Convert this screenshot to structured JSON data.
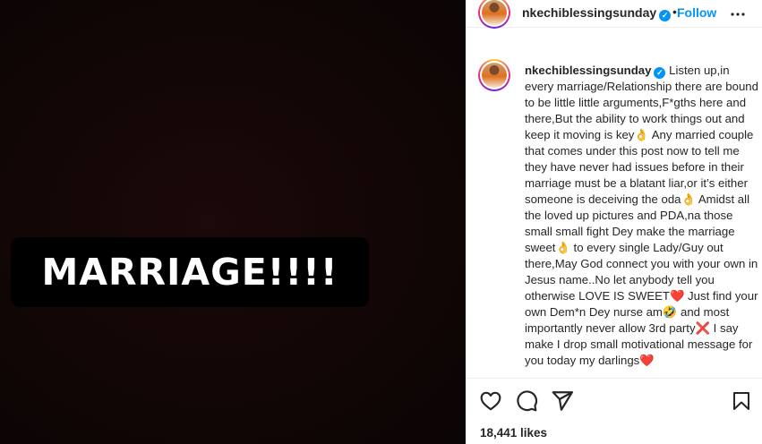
{
  "media": {
    "overlay_text": "MARRIAGE!!!!"
  },
  "header": {
    "username": "nkechiblessingsunday",
    "separator": "•",
    "follow_label": "Follow"
  },
  "caption": {
    "username": "nkechiblessingsunday",
    "text": " Listen up,in every marriage/Relationship there are bound to be little little arguments,F*gths here and there,But the ability to work things out and keep it moving is key👌 Any married couple that comes under this post now to tell me they have never had issues before in their marriage must be a blatant liar,or it’s either someone is deceiving the oda👌 Amidst all the loved up pictures and PDA,na those small small fight Dey make the marriage sweet👌 to every single Lady/Guy out there,May God connect you with your own in Jesus name..No let anybody tell you otherwise LOVE IS SWEET❤️ Just find your own Dem*n Dey nurse am🤣 and most importantly never allow 3rd party❌ I say make I drop small motivational message for you today my darlings❤️"
  },
  "footer": {
    "likes": "18,441 likes"
  },
  "icons": {
    "verified": "verified-badge-icon",
    "more": "more-options-icon",
    "like": "heart-icon",
    "comment": "comment-icon",
    "share": "share-icon",
    "save": "bookmark-icon"
  },
  "colors": {
    "accent": "#0095f6",
    "text": "#262626",
    "media_bg": "#120606"
  }
}
